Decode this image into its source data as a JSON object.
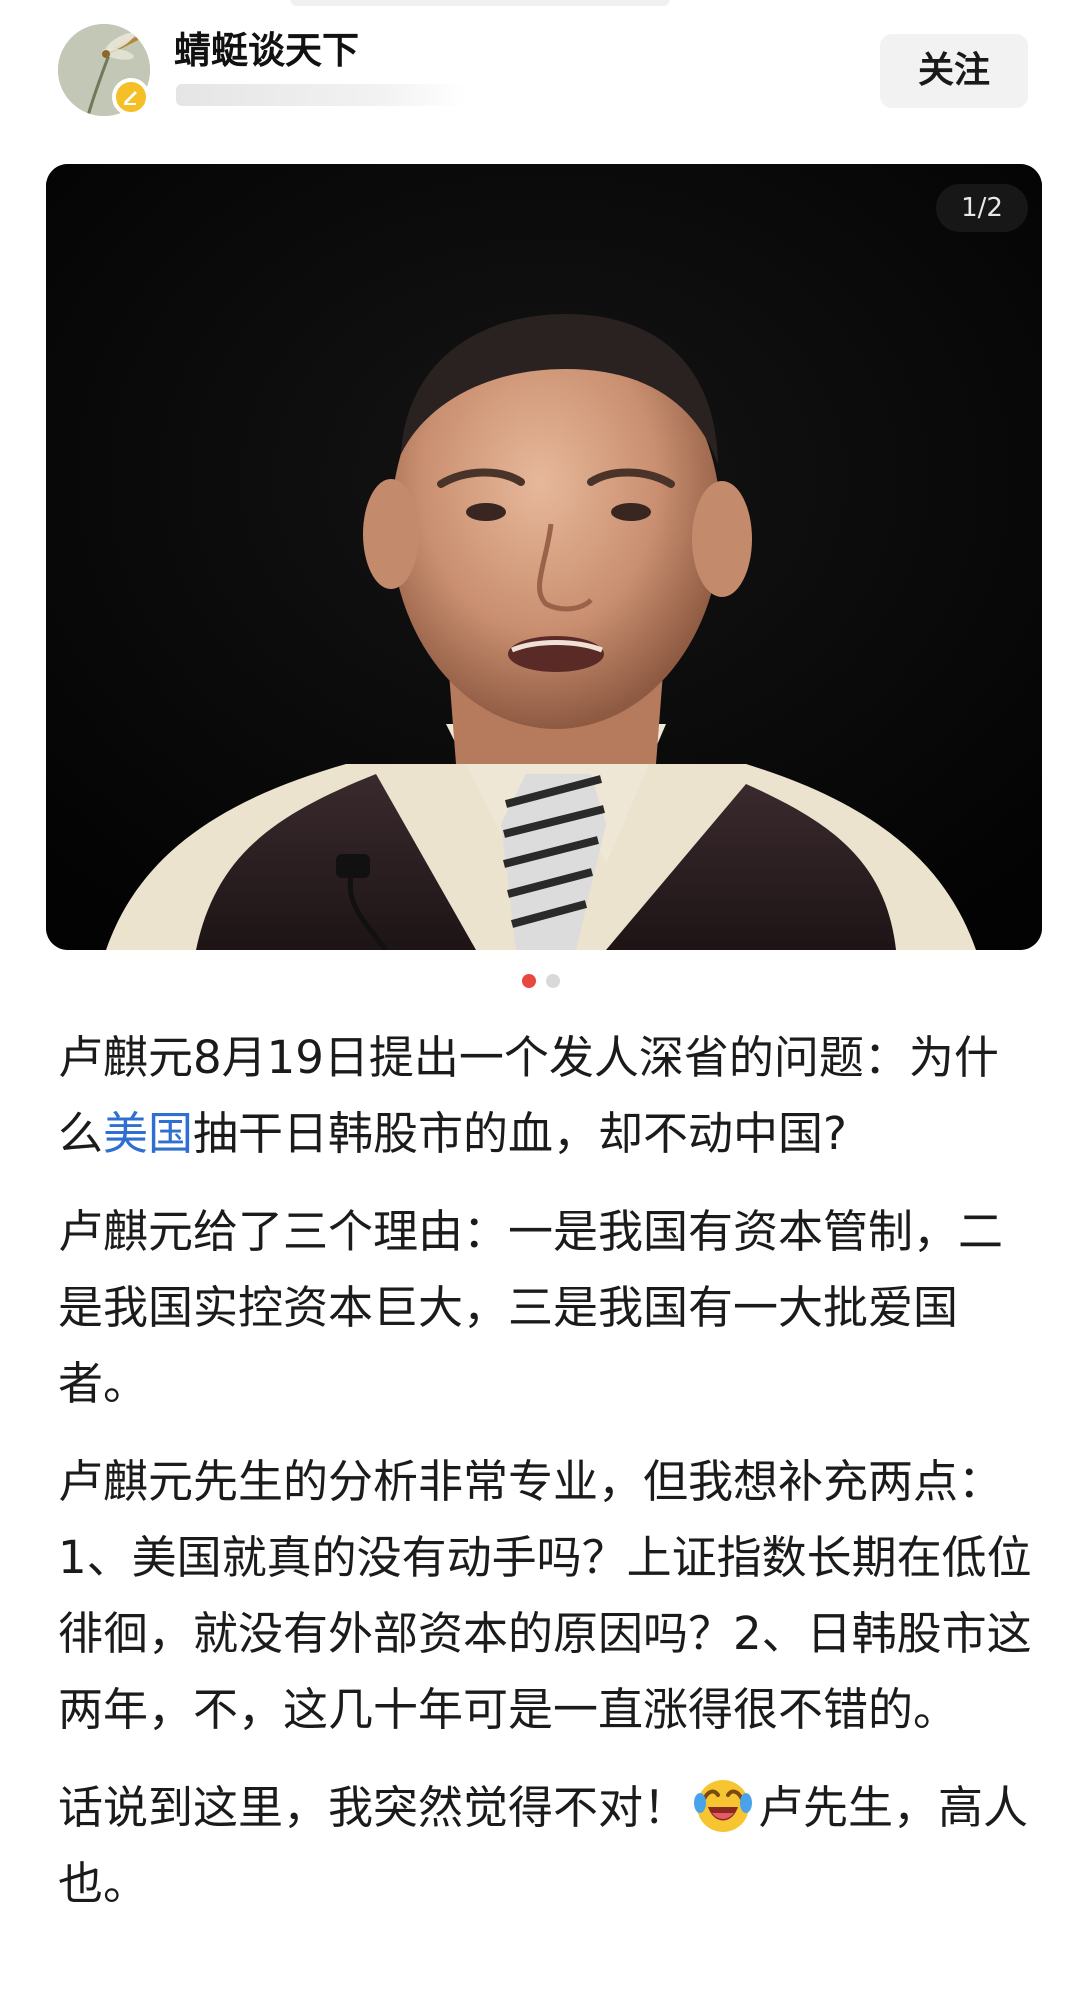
{
  "author": {
    "name": "蜻蜓谈天下",
    "avatar_icon": "dragonfly-avatar",
    "badge_icon": "verified-badge-icon",
    "badge_color": "#f4bf27"
  },
  "follow_button": {
    "label": "关注"
  },
  "gallery": {
    "counter": "1/2",
    "current_index": 1,
    "total": 2,
    "active_dot_color": "#e9473f",
    "inactive_dot_color": "#d9d9d9"
  },
  "post": {
    "p1_before": "卢麒元8月19日提出一个发人深省的问题：为什么",
    "p1_link": "美国",
    "p1_after": "抽干日韩股市的血，却不动中国?",
    "link_color": "#2f6fd1",
    "p2": "卢麒元给了三个理由：一是我国有资本管制，二是我国实控资本巨大，三是我国有一大批爱国者。",
    "p3": "卢麒元先生的分析非常专业，但我想补充两点：1、美国就真的没有动手吗？上证指数长期在低位徘徊，就没有外部资本的原因吗？2、日韩股市这两年，不，这几十年可是一直涨得很不错的。",
    "p4_before": "话说到这里，我突然觉得不对！",
    "emoji_icon": "laughing-crying-emoji-icon",
    "p4_after": "卢先生，高人也。"
  }
}
